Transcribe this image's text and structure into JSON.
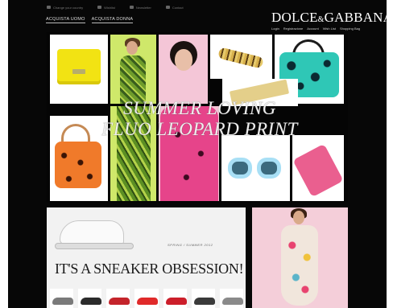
{
  "utility_bar": {
    "items": [
      "Change your country",
      "Wishlist",
      "Newsletter",
      "Contact"
    ]
  },
  "nav": {
    "items": [
      "ACQUISTA UOMO",
      "ACQUISTA DONNA"
    ]
  },
  "brand": {
    "logo_left": "DOLCE",
    "logo_amp": "&",
    "logo_right": "GABBANA"
  },
  "account": {
    "items": [
      "Login",
      "Registrazione",
      "Account",
      "Wish List",
      "Shopping Bag"
    ]
  },
  "hero": {
    "headline_line1": "SUMMER LOVING",
    "headline_line2": "FLUO LEOPARD PRINT"
  },
  "promo": {
    "season": "SPRING / SUMMER 2012",
    "headline": "IT'S A SNEAKER OBSESSION!"
  },
  "colors": {
    "background": "#070707",
    "yellow_bag": "#f2e313",
    "teal_bag": "#2fc7b6",
    "pink": "#e6448a",
    "lime": "#cfe86a"
  },
  "shoes": [
    {
      "color": "#7a7a7a"
    },
    {
      "color": "#2b2b2b"
    },
    {
      "color": "#c4242b"
    },
    {
      "color": "#e02a2a"
    },
    {
      "color": "#cc1e2a"
    },
    {
      "color": "#3a3a3a"
    },
    {
      "color": "#8a8a8a"
    }
  ]
}
